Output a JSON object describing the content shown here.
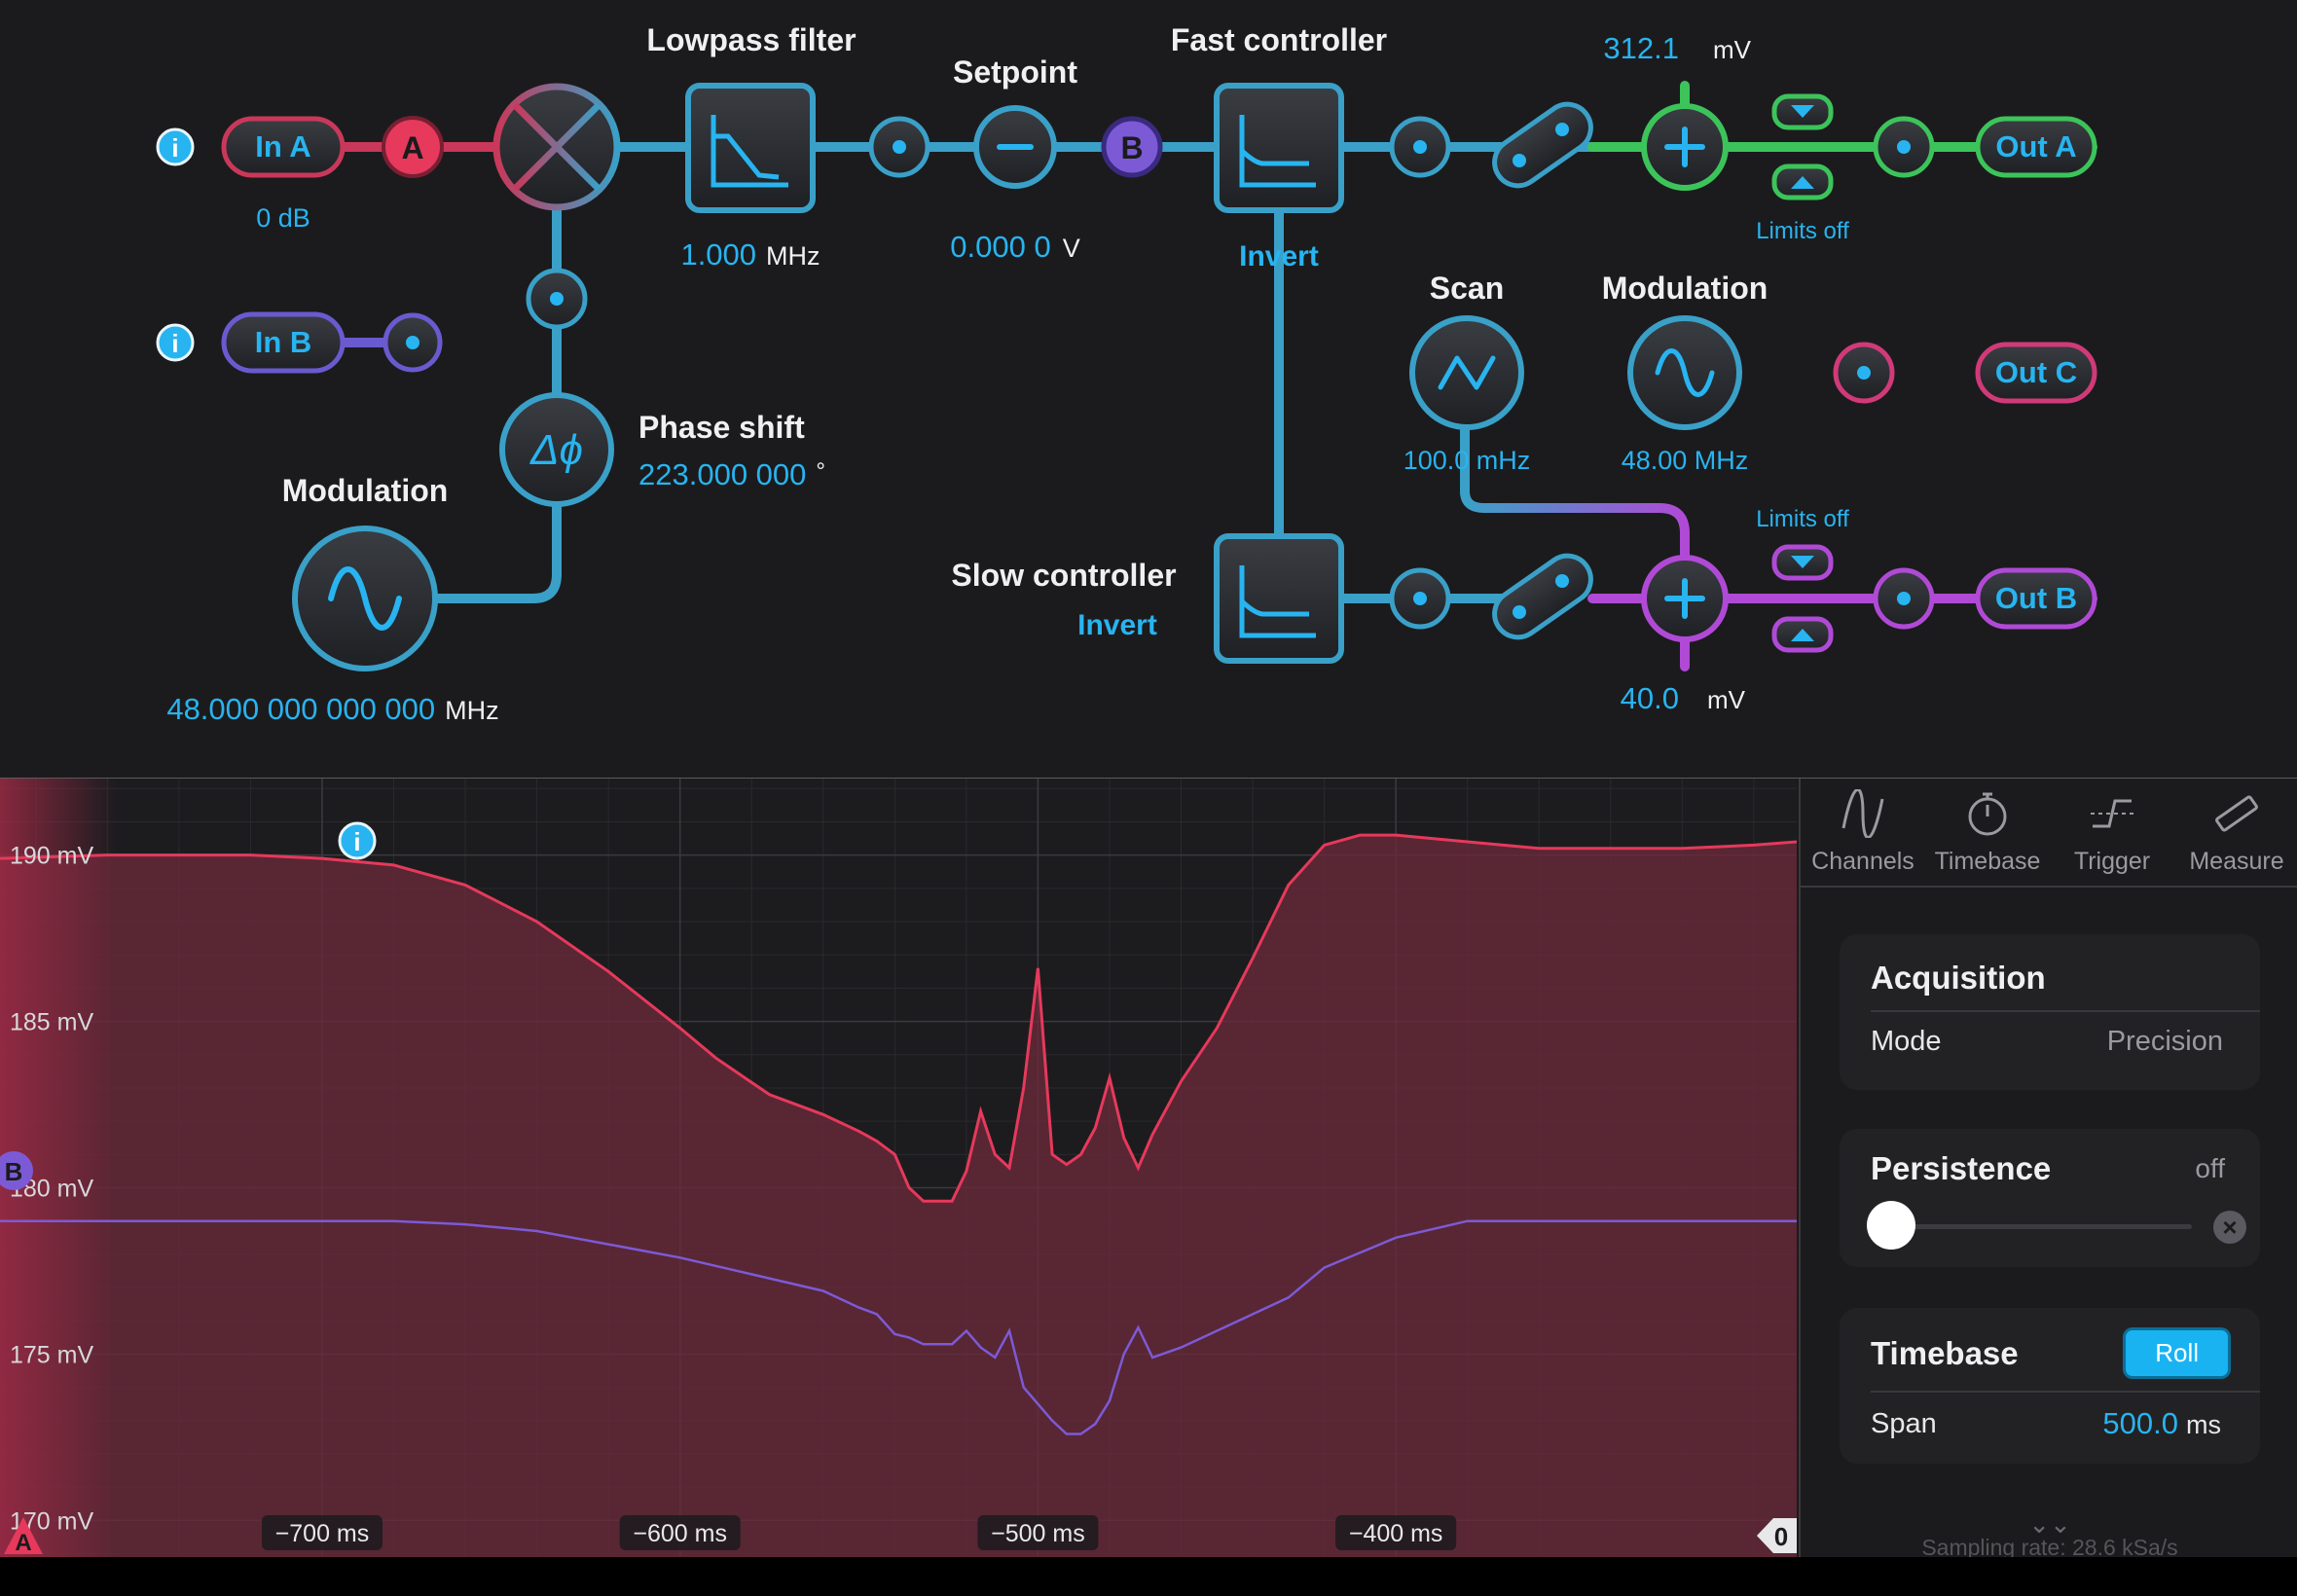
{
  "colors": {
    "accent": "#28b4f0",
    "channel_a": "#e6395b",
    "channel_b": "#7c5ad6",
    "out_a": "#3cc45a",
    "out_b": "#b04ad6",
    "out_c": "#d03a78"
  },
  "diagram": {
    "in_a": {
      "label": "In A",
      "gain": "0 dB",
      "tag": "A"
    },
    "in_b": {
      "label": "In B"
    },
    "lowpass": {
      "title": "Lowpass filter",
      "value": "1.000",
      "unit": "MHz"
    },
    "setpoint": {
      "title": "Setpoint",
      "value": "0.000 0",
      "unit": "V"
    },
    "fast_controller": {
      "title": "Fast controller",
      "invert": "Invert"
    },
    "slow_controller": {
      "title": "Slow controller",
      "invert": "Invert"
    },
    "channel_b_tag": "B",
    "phase_shift": {
      "title": "Phase shift",
      "value": "223.000 000",
      "unit": "°",
      "symbol": "Δϕ"
    },
    "modulation_left": {
      "title": "Modulation",
      "value": "48.000 000 000 000",
      "unit": "MHz"
    },
    "scan": {
      "title": "Scan",
      "value": "100.0 mHz"
    },
    "modulation_right": {
      "title": "Modulation",
      "value": "48.00 MHz"
    },
    "out_a": {
      "label": "Out A",
      "offset_value": "312.1",
      "offset_unit": "mV",
      "limits": "Limits off"
    },
    "out_b": {
      "label": "Out B",
      "offset_value": "40.0",
      "offset_unit": "mV",
      "limits": "Limits off"
    },
    "out_c": {
      "label": "Out C"
    },
    "info_icon": "i"
  },
  "scope": {
    "y_labels": [
      "190 mV",
      "185 mV",
      "180 mV",
      "175 mV",
      "170 mV"
    ],
    "x_labels": [
      "−700 ms",
      "−600 ms",
      "−500 ms",
      "−400 ms"
    ],
    "trigger_marker": "0",
    "marker_a": "A",
    "marker_b": "B"
  },
  "chart_data": {
    "type": "line",
    "xlabel": "",
    "ylabel": "",
    "xlim": [
      -790,
      -288
    ],
    "ylim": [
      168.9,
      192.3
    ],
    "x_ticks": [
      -700,
      -600,
      -500,
      -400
    ],
    "y_ticks": [
      190,
      185,
      180,
      175,
      170
    ],
    "grid": true,
    "series": [
      {
        "name": "A",
        "color": "#e6395b",
        "x": [
          -790,
          -760,
          -740,
          -720,
          -700,
          -680,
          -660,
          -640,
          -620,
          -600,
          -590,
          -575,
          -560,
          -550,
          -545,
          -540,
          -536,
          -532,
          -528,
          -524,
          -520,
          -516,
          -512,
          -508,
          -504,
          -500,
          -496,
          -492,
          -488,
          -484,
          -480,
          -476,
          -472,
          -468,
          -460,
          -450,
          -440,
          -430,
          -420,
          -410,
          -400,
          -380,
          -360,
          -340,
          -320,
          -300,
          -288
        ],
        "y": [
          189.9,
          190.0,
          190.0,
          190.0,
          189.9,
          189.7,
          189.1,
          188.0,
          186.5,
          184.8,
          183.9,
          182.8,
          182.2,
          181.7,
          181.4,
          181.0,
          180.0,
          179.6,
          179.6,
          179.6,
          180.5,
          182.3,
          181.0,
          180.6,
          183.0,
          186.6,
          181.0,
          180.7,
          181.0,
          181.8,
          183.3,
          181.5,
          180.6,
          181.6,
          183.2,
          184.8,
          186.9,
          189.1,
          190.3,
          190.6,
          190.6,
          190.4,
          190.2,
          190.2,
          190.2,
          190.3,
          190.4
        ]
      },
      {
        "name": "B",
        "color": "#7c5ad6",
        "x": [
          -790,
          -760,
          -720,
          -700,
          -680,
          -660,
          -640,
          -620,
          -600,
          -580,
          -560,
          -550,
          -545,
          -540,
          -536,
          -532,
          -528,
          -524,
          -520,
          -516,
          -512,
          -508,
          -504,
          -500,
          -496,
          -492,
          -488,
          -484,
          -480,
          -476,
          -472,
          -468,
          -460,
          -450,
          -440,
          -430,
          -420,
          -400,
          -380,
          -360,
          -340,
          -320,
          -300,
          -288
        ],
        "y": [
          179.0,
          179.0,
          179.0,
          179.0,
          179.0,
          178.9,
          178.7,
          178.3,
          177.9,
          177.4,
          176.9,
          176.4,
          176.2,
          175.6,
          175.5,
          175.3,
          175.3,
          175.3,
          175.7,
          175.2,
          174.9,
          175.7,
          174.0,
          173.5,
          173.0,
          172.6,
          172.6,
          172.9,
          173.6,
          175.0,
          175.8,
          174.9,
          175.2,
          175.7,
          176.2,
          176.7,
          177.6,
          178.5,
          179.0,
          179.0,
          179.0,
          179.0,
          179.0,
          179.0
        ]
      }
    ]
  },
  "side_panel": {
    "tabs": [
      {
        "label": "Channels",
        "icon": "sine-icon"
      },
      {
        "label": "Timebase",
        "icon": "stopwatch-icon"
      },
      {
        "label": "Trigger",
        "icon": "trigger-icon"
      },
      {
        "label": "Measure",
        "icon": "ruler-icon"
      }
    ],
    "acquisition": {
      "title": "Acquisition",
      "mode_label": "Mode",
      "mode_value": "Precision"
    },
    "persistence": {
      "title": "Persistence",
      "status": "off",
      "level": 0
    },
    "timebase": {
      "title": "Timebase",
      "roll_label": "Roll",
      "span_label": "Span",
      "span_value": "500.0",
      "span_unit": "ms"
    },
    "sampling_rate": "Sampling rate: 28.6 kSa/s"
  }
}
